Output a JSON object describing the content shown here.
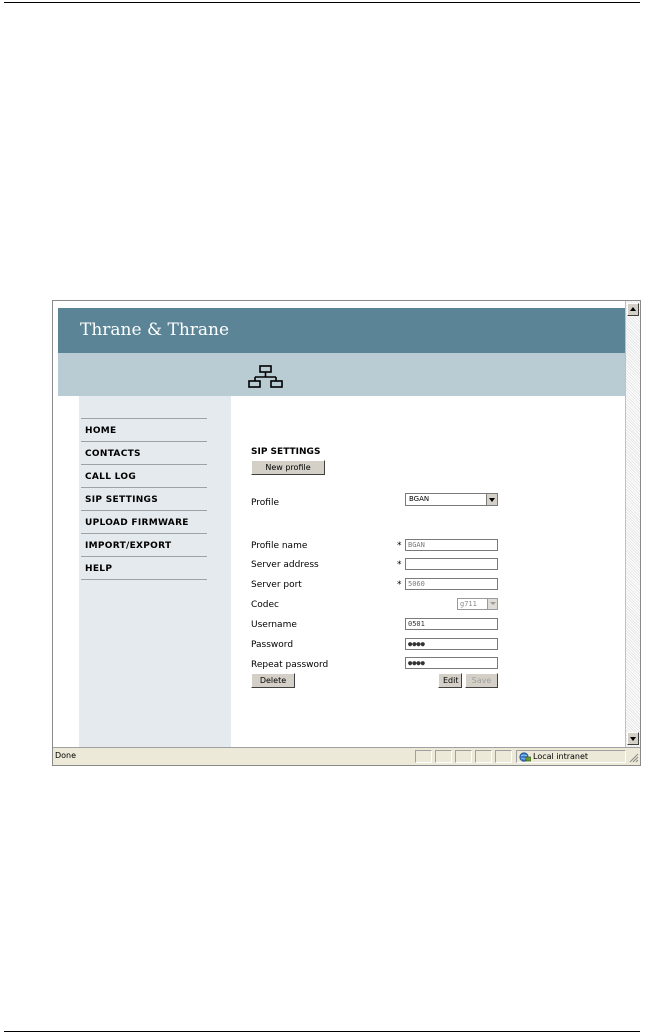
{
  "colors": {
    "banner_bg": "#5b8596",
    "iconbar_bg": "#b9cbd3",
    "sidebar_bg": "#e4eaee"
  },
  "banner": {
    "logo_text": "Thrane & Thrane"
  },
  "iconbar": {
    "icon": "network-icon"
  },
  "sidebar": {
    "items": [
      {
        "label": "HOME"
      },
      {
        "label": "CONTACTS"
      },
      {
        "label": "CALL LOG"
      },
      {
        "label": "SIP SETTINGS"
      },
      {
        "label": "UPLOAD FIRMWARE"
      },
      {
        "label": "IMPORT/EXPORT"
      },
      {
        "label": "HELP"
      }
    ]
  },
  "main": {
    "title": "SIP SETTINGS",
    "new_profile_label": "New profile",
    "profile": {
      "label": "Profile",
      "selected": "BGAN"
    },
    "required_marker": "*",
    "fields": {
      "profile_name": {
        "label": "Profile name",
        "value": "BGAN"
      },
      "server_address": {
        "label": "Server address",
        "value": ""
      },
      "server_port": {
        "label": "Server port",
        "value": "5060"
      },
      "codec": {
        "label": "Codec",
        "selected": "g711"
      },
      "username": {
        "label": "Username",
        "value": "0501"
      },
      "password": {
        "label": "Password",
        "value": "●●●●"
      },
      "repeat_password": {
        "label": "Repeat password",
        "value": "●●●●"
      }
    },
    "buttons": {
      "delete": "Delete",
      "edit": "Edit",
      "save": "Save"
    }
  },
  "statusbar": {
    "status": "Done",
    "zone": "Local intranet"
  }
}
